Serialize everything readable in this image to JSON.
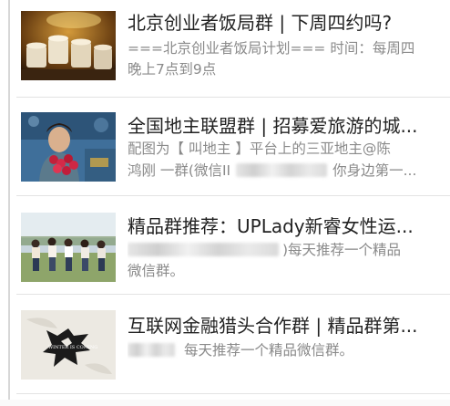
{
  "feed": {
    "items": [
      {
        "title": "北京创业者饭局群 | 下周四约吗?",
        "desc_line1": "===北京创业者饭局计划=== 时间：每周四",
        "desc_line2": "晚上7点到9点"
      },
      {
        "title": "全国地主联盟群 | 招募爱旅游的城...",
        "desc_line1_a": "配图为【 叫地主 】平台上的三亚地主@陈",
        "desc_line2_a": "鸿刚 一群(微信II",
        "desc_line2_b": "你身边第一..."
      },
      {
        "title": "精品群推荐：UPLady新睿女性运...",
        "desc_line1_b": ")每天推荐一个精品",
        "desc_line2": "微信群。"
      },
      {
        "title": "互联网金融猎头合作群 | 精品群第...",
        "desc_line1_b": "每天推荐一个精品微信群。",
        "thumb_text": "WINTER IS COMING"
      }
    ]
  }
}
